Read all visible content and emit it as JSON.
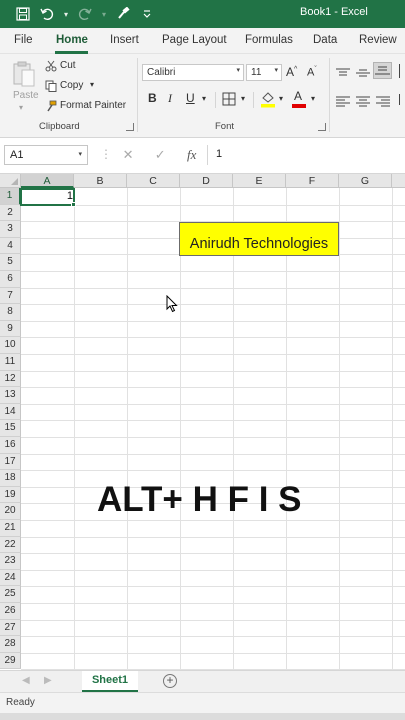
{
  "titlebar": {
    "title": "Book1 - Excel",
    "qat_icons": [
      "save-icon",
      "undo-icon",
      "redo-icon",
      "format-painter-icon",
      "customize-icon"
    ]
  },
  "tabs": [
    {
      "label": "File"
    },
    {
      "label": "Home"
    },
    {
      "label": "Insert"
    },
    {
      "label": "Page Layout"
    },
    {
      "label": "Formulas"
    },
    {
      "label": "Data"
    },
    {
      "label": "Review"
    }
  ],
  "ribbon": {
    "clipboard": {
      "paste": "Paste",
      "cut": "Cut",
      "copy": "Copy",
      "format_painter": "Format Painter",
      "group_label": "Clipboard"
    },
    "font": {
      "font_name": "Calibri",
      "font_size": "11",
      "bold": "B",
      "italic": "I",
      "underline": "U",
      "font_color_letter": "A",
      "group_label": "Font"
    }
  },
  "formula_bar": {
    "name_box": "A1",
    "cancel": "✕",
    "enter": "✓",
    "fx": "fx",
    "value": "1"
  },
  "grid": {
    "columns": [
      "A",
      "B",
      "C",
      "D",
      "E",
      "F",
      "G"
    ],
    "rows": [
      "1",
      "2",
      "3",
      "4",
      "5",
      "6",
      "7",
      "8",
      "9",
      "10",
      "11",
      "12",
      "13",
      "14",
      "15",
      "16",
      "17",
      "18",
      "19",
      "20",
      "21",
      "22",
      "23",
      "24",
      "25",
      "26",
      "27",
      "28",
      "29"
    ],
    "a1_value": "1",
    "highlight_text": "Anirudh Technologies",
    "overlay_text": "ALT+ H F I S"
  },
  "sheets": {
    "active": "Sheet1",
    "add": "+"
  },
  "status": {
    "text": "Ready"
  },
  "colors": {
    "excel_green": "#217346",
    "highlight_fill": "#ffff00"
  }
}
